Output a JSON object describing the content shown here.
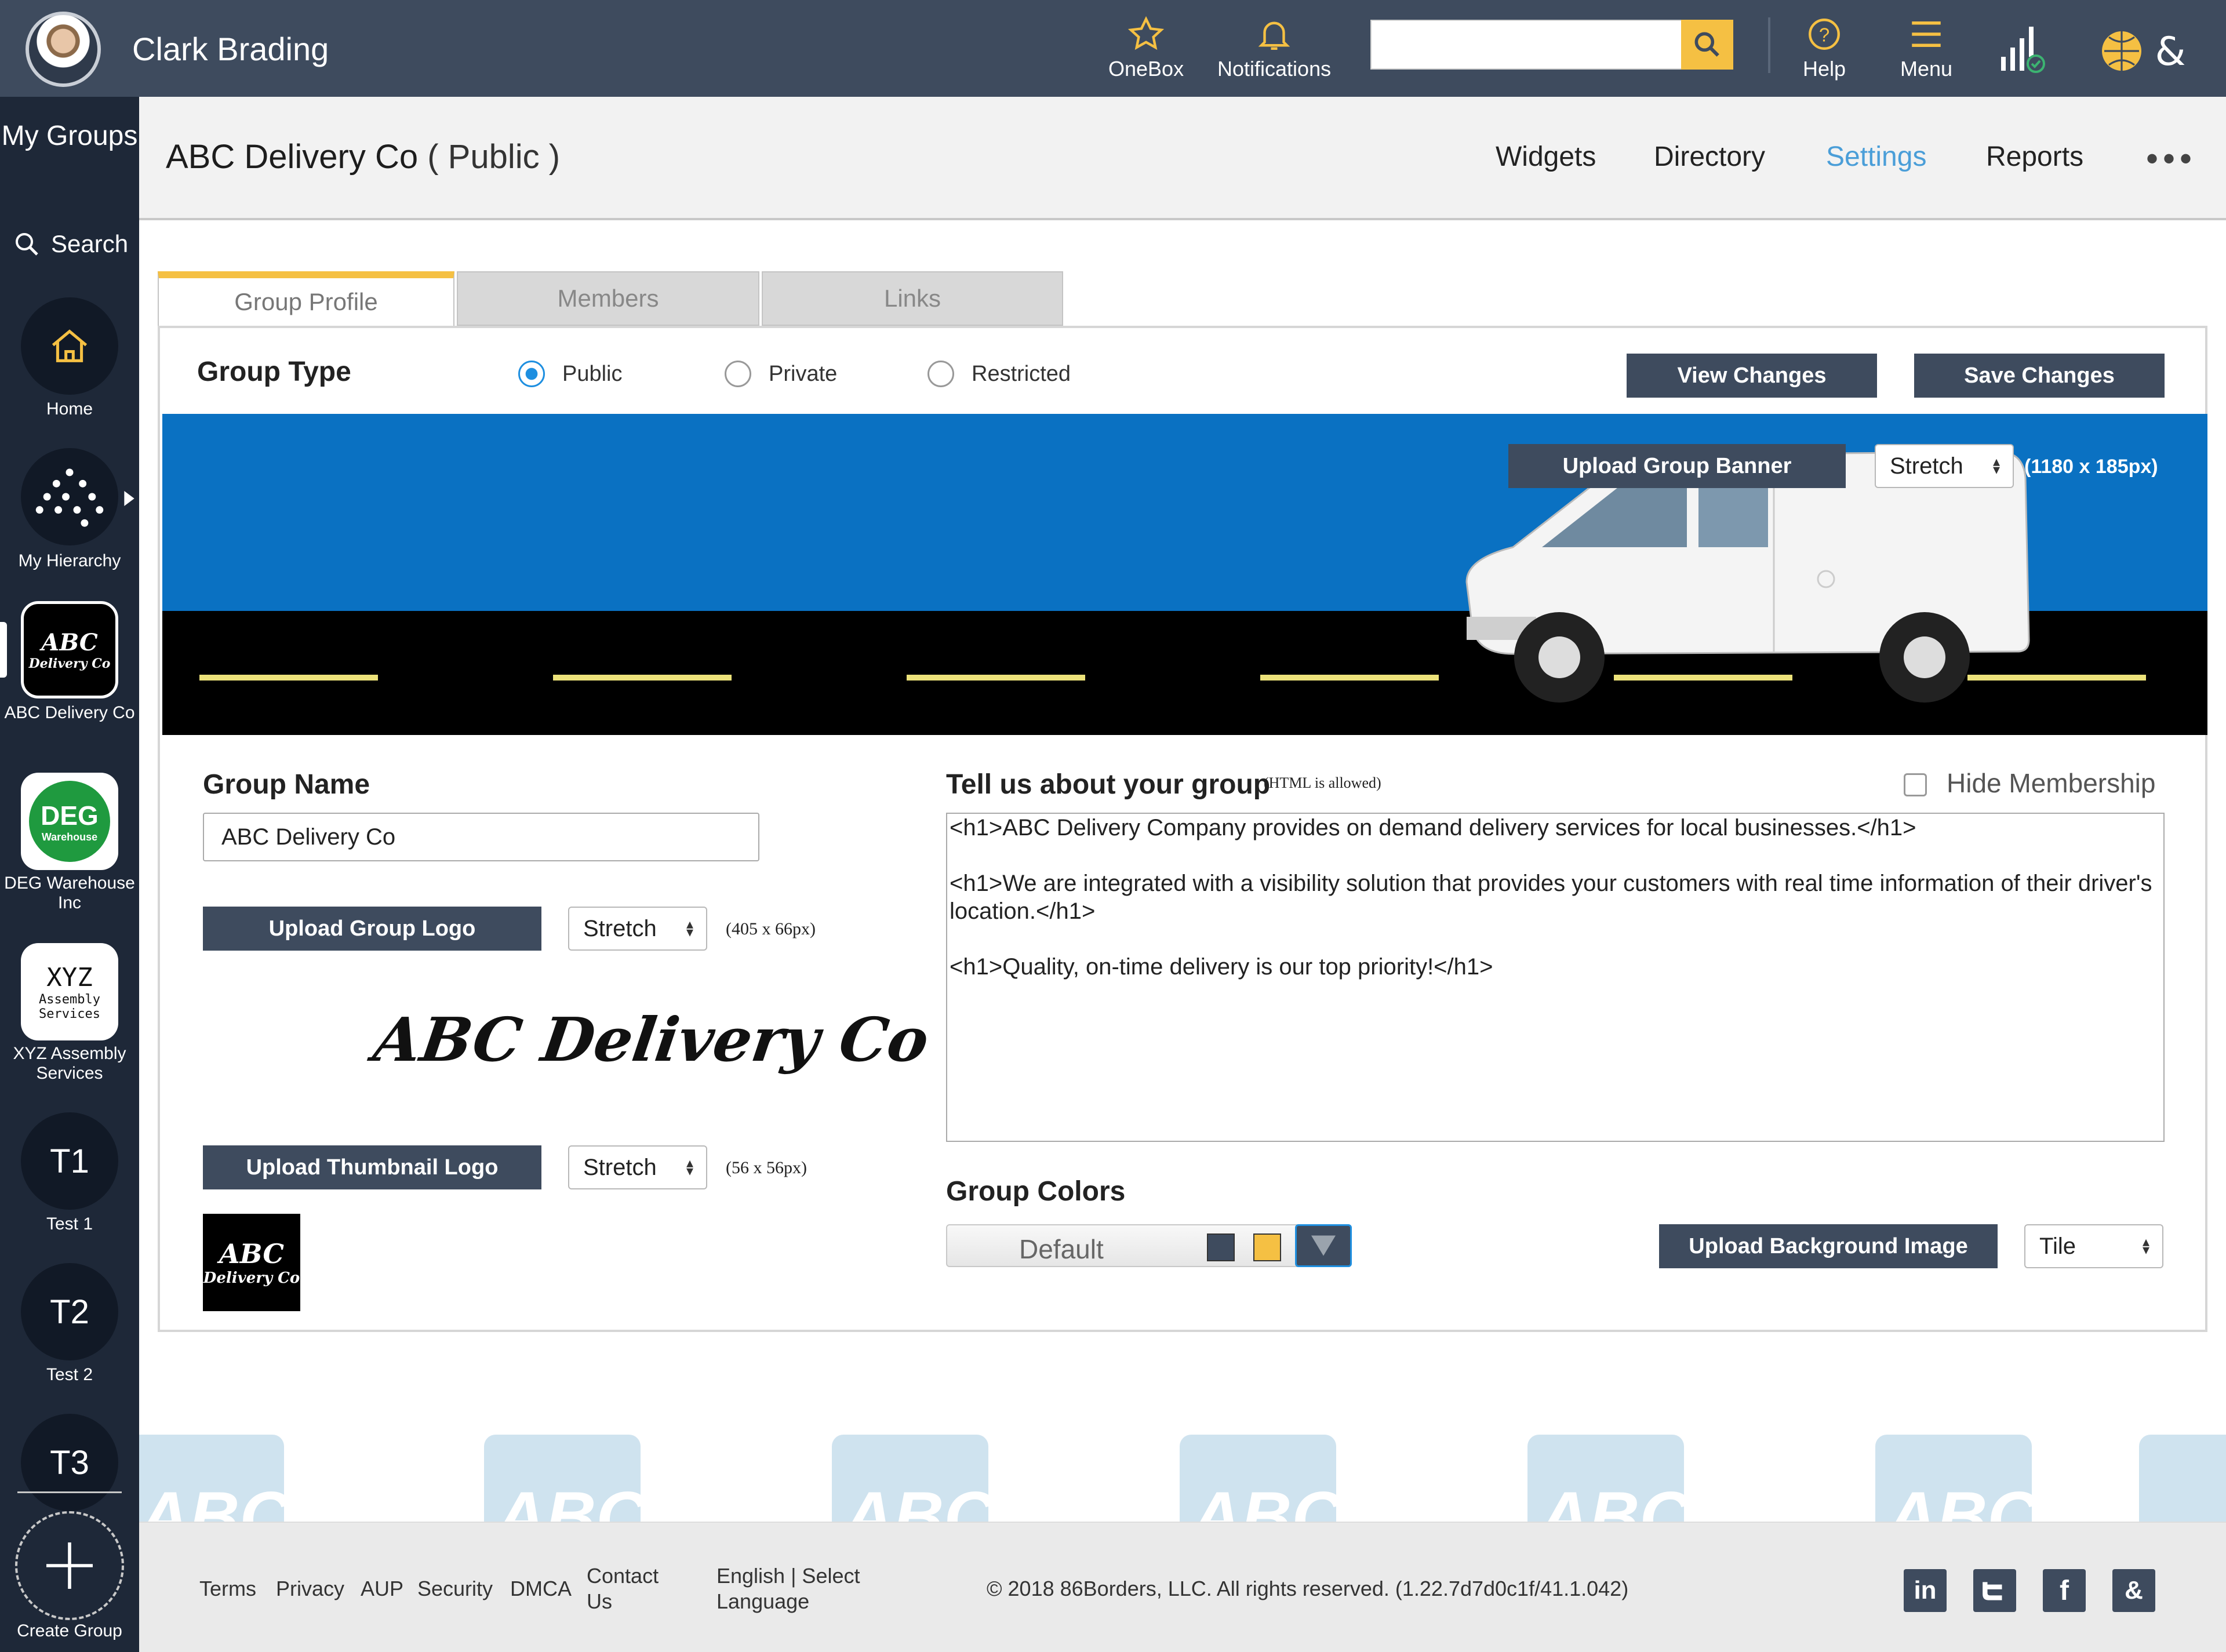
{
  "topbar": {
    "user_name": "Clark Brading",
    "onebox_label": "OneBox",
    "notifications_label": "Notifications",
    "search_placeholder": "",
    "help_label": "Help",
    "menu_label": "Menu"
  },
  "sidebar": {
    "my_groups": "My Groups",
    "search": "Search",
    "items": [
      {
        "label": "Home"
      },
      {
        "label": "My Hierarchy"
      },
      {
        "label": "ABC Delivery Co",
        "tile_line1": "ABC",
        "tile_line2": "Delivery Co"
      },
      {
        "label": "DEG Warehouse Inc",
        "tile_line1": "DEG",
        "tile_line2": "Warehouse"
      },
      {
        "label": "XYZ Assembly Services",
        "tile_line1": "XYZ",
        "tile_line2": "Assembly",
        "tile_line3": "Services"
      },
      {
        "label": "Test 1",
        "tile": "T1"
      },
      {
        "label": "Test 2",
        "tile": "T2"
      },
      {
        "tile": "T3"
      }
    ],
    "create_group": "Create Group"
  },
  "header": {
    "title": "ABC Delivery Co",
    "visibility": "( Public )",
    "nav": [
      "Widgets",
      "Directory",
      "Settings",
      "Reports"
    ],
    "active_nav": "Settings",
    "more": "•••"
  },
  "background_watermark": "ABC",
  "tabs": [
    "Group Profile",
    "Members",
    "Links"
  ],
  "group_type": {
    "label": "Group Type",
    "options": [
      "Public",
      "Private",
      "Restricted"
    ],
    "selected": "Public"
  },
  "actions": {
    "view_changes": "View Changes",
    "save_changes": "Save Changes"
  },
  "banner": {
    "upload_label": "Upload Group Banner",
    "mode": "Stretch",
    "size_hint": "(1180 x 185px)"
  },
  "group_name": {
    "label": "Group Name",
    "value": "ABC Delivery Co"
  },
  "logo": {
    "upload_label": "Upload Group Logo",
    "mode": "Stretch",
    "size_hint": "(405 x 66px)",
    "preview_text": "ABC Delivery Co"
  },
  "thumbnail": {
    "upload_label": "Upload Thumbnail Logo",
    "mode": "Stretch",
    "size_hint": "(56 x 56px)",
    "line1": "ABC",
    "line2": "Delivery Co"
  },
  "about": {
    "label": "Tell us about your group",
    "hint": "(HTML is allowed)",
    "hide_membership": "Hide Membership",
    "text": "<h1>ABC Delivery Company provides on demand delivery services for local businesses.</h1>\n\n<h1>We are integrated with a visibility solution that provides your customers with real time information of their driver's location.</h1>\n\n<h1>Quality, on-time delivery is our top priority!</h1>"
  },
  "group_colors": {
    "label": "Group Colors",
    "value": "Default",
    "swatch_primary": "#3e4b5e",
    "swatch_accent": "#f5c043",
    "upload_bg_label": "Upload Background Image",
    "bg_mode": "Tile"
  },
  "footer": {
    "links": [
      "Terms",
      "Privacy",
      "AUP",
      "Security",
      "DMCA",
      "Contact Us"
    ],
    "language": "English | Select Language",
    "copyright": "© 2018 86Borders, LLC. All rights reserved. (1.22.7d7d0c1f/41.1.042)",
    "social": [
      "linkedin-icon",
      "twitter-icon",
      "facebook-icon",
      "86borders-icon"
    ]
  },
  "colors": {
    "topbar": "#3e4b5e",
    "sidebar": "#1e2838",
    "accent": "#f5c043",
    "active_link": "#4a9ed8",
    "banner_sky": "#0a71c2"
  }
}
